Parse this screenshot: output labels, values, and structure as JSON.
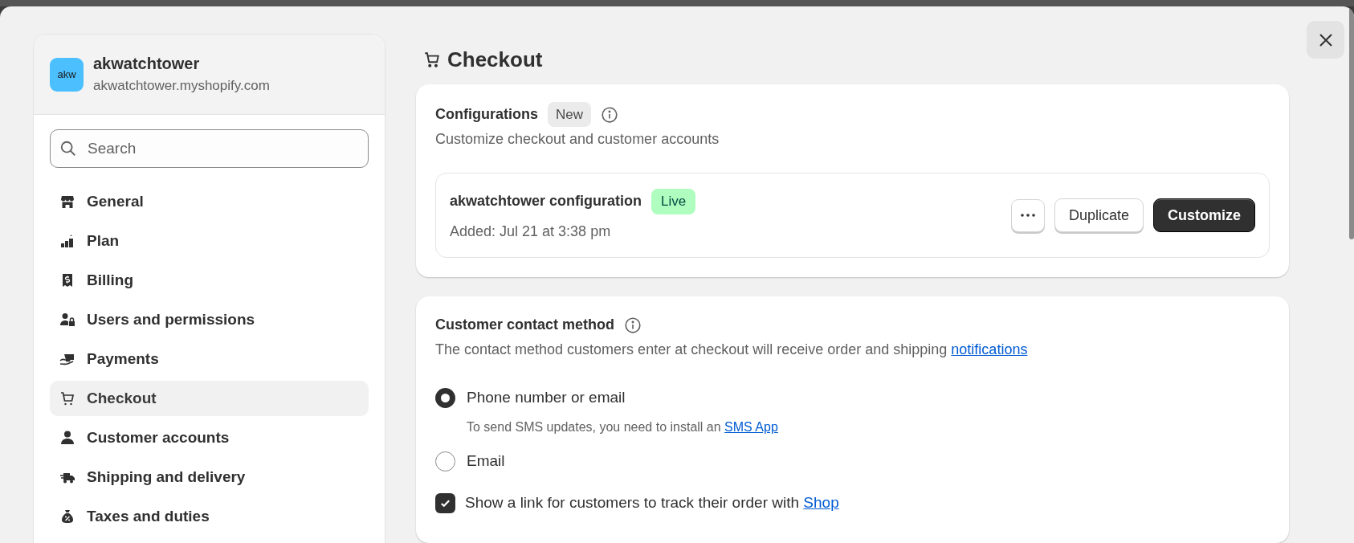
{
  "store": {
    "avatar_text": "akw",
    "name": "akwatchtower",
    "domain": "akwatchtower.myshopify.com"
  },
  "search": {
    "placeholder": "Search"
  },
  "nav": [
    {
      "kind": "store",
      "label": "General",
      "selected": false
    },
    {
      "kind": "plan",
      "label": "Plan",
      "selected": false
    },
    {
      "kind": "billing",
      "label": "Billing",
      "selected": false
    },
    {
      "kind": "users",
      "label": "Users and permissions",
      "selected": false
    },
    {
      "kind": "payments",
      "label": "Payments",
      "selected": false
    },
    {
      "kind": "cart",
      "label": "Checkout",
      "selected": true
    },
    {
      "kind": "person",
      "label": "Customer accounts",
      "selected": false
    },
    {
      "kind": "truck",
      "label": "Shipping and delivery",
      "selected": false
    },
    {
      "kind": "tax",
      "label": "Taxes and duties",
      "selected": false
    }
  ],
  "page_title": "Checkout",
  "configurations": {
    "title": "Configurations",
    "badge": "New",
    "subtitle": "Customize checkout and customer accounts",
    "items": [
      {
        "name": "akwatchtower configuration",
        "status": "Live",
        "added": "Added: Jul 21 at 3:38 pm",
        "buttons": [
          {
            "kind": "more"
          },
          {
            "kind": "secondary",
            "label": "Duplicate"
          },
          {
            "kind": "primary",
            "label": "Customize"
          }
        ]
      }
    ]
  },
  "contact": {
    "title": "Customer contact method",
    "description": {
      "text": "The contact method customers enter at checkout will receive order and shipping",
      "link": "notifications"
    },
    "options": [
      {
        "label": "Phone number or email",
        "selected": true,
        "help": {
          "text": "To send SMS updates, you need to install an",
          "link": "SMS App"
        }
      },
      {
        "label": "Email",
        "selected": false
      }
    ],
    "tracking": {
      "text": "Show a link for customers to track their order with",
      "link": "Shop",
      "checked": true
    }
  }
}
